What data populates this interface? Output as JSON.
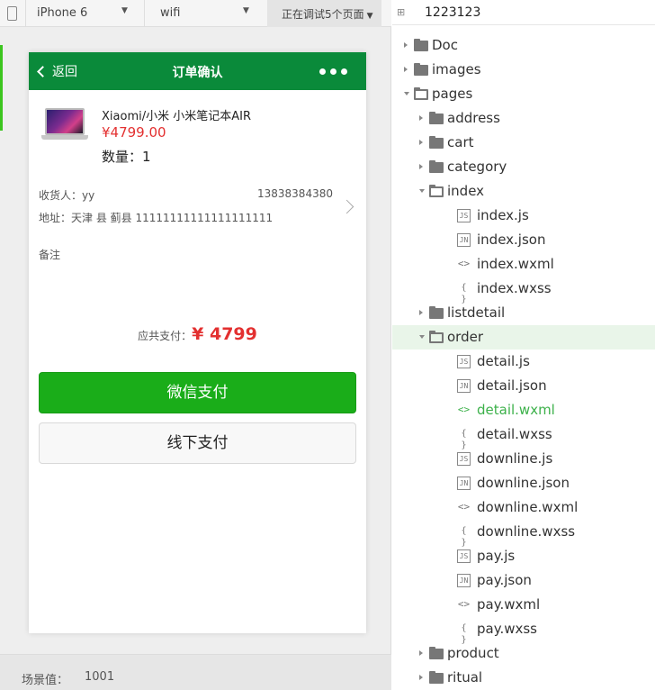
{
  "toolbar": {
    "device": "iPhone 6",
    "network": "wifi",
    "debug_pages": "正在调试5个页面"
  },
  "nav": {
    "back_label": "返回",
    "title": "订单确认"
  },
  "product": {
    "name": "Xiaomi/小米 小米笔记本AIR",
    "price": "¥4799.00",
    "quantity": "数量：1"
  },
  "address": {
    "receiver": "收货人：yy",
    "phone": "13838384380",
    "line": "地址：天津 县 蓟县 11111111111111111111"
  },
  "remark_label": "备注",
  "total": {
    "label": "应共支付：",
    "amount": "¥ 4799"
  },
  "buttons": {
    "wechat_pay": "微信支付",
    "offline_pay": "线下支付"
  },
  "scene": {
    "label": "场景值：",
    "value": "1001"
  },
  "colors": {
    "nav_bar": "#0a8a3a",
    "pay_button": "#1aad19",
    "price": "#e33030",
    "active_file": "#3cb14a",
    "selected_row": "#e9f5e9"
  },
  "tree": {
    "project": "1223123",
    "rows": [
      {
        "label": "Doc",
        "type": "folder"
      },
      {
        "label": "images",
        "type": "folder"
      },
      {
        "label": "pages",
        "type": "folder-open"
      },
      {
        "label": "address",
        "type": "folder"
      },
      {
        "label": "cart",
        "type": "folder"
      },
      {
        "label": "category",
        "type": "folder"
      },
      {
        "label": "index",
        "type": "folder-open"
      },
      {
        "label": "index.js",
        "type": "js"
      },
      {
        "label": "index.json",
        "type": "json"
      },
      {
        "label": "index.wxml",
        "type": "wxml"
      },
      {
        "label": "index.wxss",
        "type": "wxss"
      },
      {
        "label": "listdetail",
        "type": "folder"
      },
      {
        "label": "order",
        "type": "folder-open",
        "selected": true
      },
      {
        "label": "detail.js",
        "type": "js"
      },
      {
        "label": "detail.json",
        "type": "json"
      },
      {
        "label": "detail.wxml",
        "type": "wxml",
        "active": true
      },
      {
        "label": "detail.wxss",
        "type": "wxss"
      },
      {
        "label": "downline.js",
        "type": "js"
      },
      {
        "label": "downline.json",
        "type": "json"
      },
      {
        "label": "downline.wxml",
        "type": "wxml"
      },
      {
        "label": "downline.wxss",
        "type": "wxss"
      },
      {
        "label": "pay.js",
        "type": "js"
      },
      {
        "label": "pay.json",
        "type": "json"
      },
      {
        "label": "pay.wxml",
        "type": "wxml"
      },
      {
        "label": "pay.wxss",
        "type": "wxss"
      },
      {
        "label": "product",
        "type": "folder"
      },
      {
        "label": "ritual",
        "type": "folder"
      }
    ]
  }
}
